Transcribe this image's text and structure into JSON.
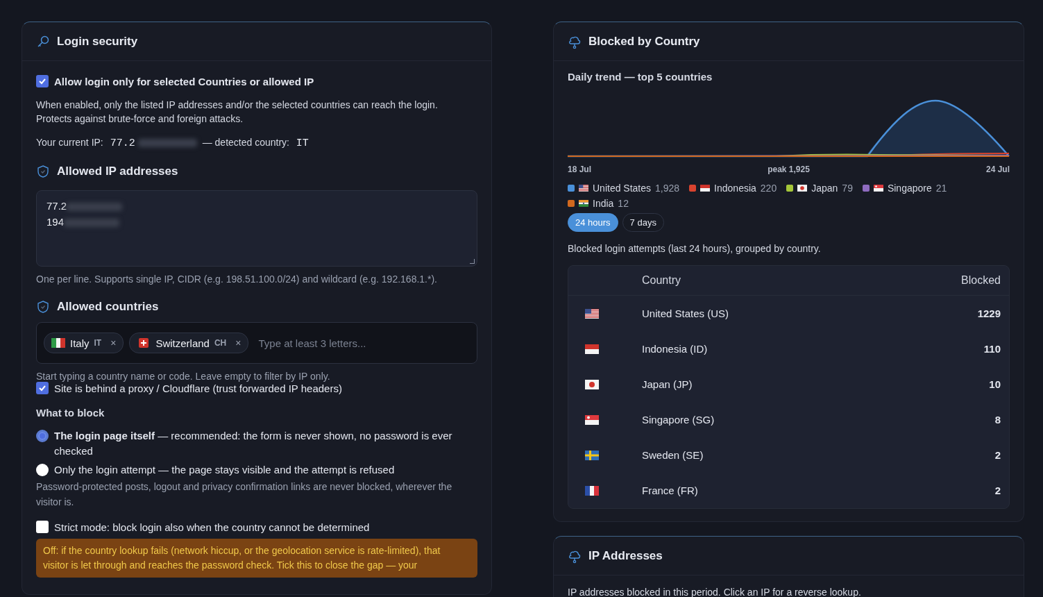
{
  "login_security": {
    "title": "Login security",
    "allow_login": {
      "label": "Allow login only for selected Countries or allowed IP",
      "checked": true
    },
    "description": "When enabled, only the listed IP addresses and/or the selected countries can reach the login. Protects against brute-force and foreign attacks.",
    "current_ip": {
      "label": "Your current IP:",
      "ip": "77.2",
      "country_label": "— detected country:",
      "country": "IT"
    },
    "allowed_ips": {
      "heading": "Allowed IP addresses",
      "lines": [
        "77.2",
        "194"
      ],
      "hint": "One per line. Supports single IP, CIDR (e.g. 198.51.100.0/24) and wildcard (e.g. 192.168.1.*)."
    },
    "allowed_countries": {
      "heading": "Allowed countries",
      "tags": [
        {
          "kind": "it",
          "name": "Italy",
          "code": "IT",
          "remove": "×"
        },
        {
          "kind": "ch",
          "name": "Switzerland",
          "code": "CH",
          "remove": "×"
        }
      ],
      "placeholder": "Type at least 3 letters...",
      "hint": "Start typing a country name or code. Leave empty to filter by IP only."
    },
    "proxy": {
      "label": "Site is behind a proxy / Cloudflare (trust forwarded IP headers)",
      "checked": true
    },
    "what_to_block": {
      "heading": "What to block",
      "options": [
        {
          "label": "**The login page itself** — recommended: the form is never shown, no password is ever checked",
          "selected": true
        },
        {
          "label": "Only the login attempt — the page stays visible and the attempt is refused",
          "selected": false
        }
      ],
      "note": "Password-protected posts, logout and privacy confirmation links are never blocked, wherever the visitor is."
    },
    "strict_mode": {
      "label": "Strict mode: block login also when the country cannot be determined",
      "checked": false
    },
    "warning": "Off: if the country lookup fails (network hiccup, or the geolocation service is rate-limited), that visitor is let through and reaches the password check. Tick this to close the gap — your"
  },
  "blocked_by_country": {
    "title": "Blocked by Country",
    "chart_title": "Daily trend — top 5 countries",
    "axis_labels": [
      "18 Jul",
      "peak 1,925",
      "24 Jul"
    ],
    "legend": [
      {
        "color": "#4a90d9",
        "kind": "us",
        "name": "United States",
        "count": "1,928"
      },
      {
        "color": "#d9432f",
        "kind": "id",
        "name": "Indonesia",
        "count": "220"
      },
      {
        "color": "#a4c639",
        "kind": "jp",
        "name": "Japan",
        "count": "79"
      },
      {
        "color": "#8e6bbf",
        "kind": "sg",
        "name": "Singapore",
        "count": "21"
      },
      {
        "color": "#d2691e",
        "kind": "in",
        "name": "India",
        "count": "12"
      }
    ],
    "ranges": [
      {
        "label": "24 hours",
        "selected": true
      },
      {
        "label": "7 days",
        "selected": false
      }
    ],
    "description": "Blocked login attempts (last 24 hours), grouped by country.",
    "table": {
      "columns": [
        "Country",
        "Blocked"
      ],
      "rows": [
        {
          "kind": "us",
          "country": "United States (US)",
          "blocked": "1229"
        },
        {
          "kind": "id",
          "country": "Indonesia (ID)",
          "blocked": "110"
        },
        {
          "kind": "jp",
          "country": "Japan (JP)",
          "blocked": "10"
        },
        {
          "kind": "sg",
          "country": "Singapore (SG)",
          "blocked": "8"
        },
        {
          "kind": "se",
          "country": "Sweden (SE)",
          "blocked": "2"
        },
        {
          "kind": "fr",
          "country": "France (FR)",
          "blocked": "2"
        }
      ]
    }
  },
  "ip_addresses": {
    "title": "IP Addresses",
    "description": "IP addresses blocked in this period. Click an IP for a reverse lookup."
  }
}
